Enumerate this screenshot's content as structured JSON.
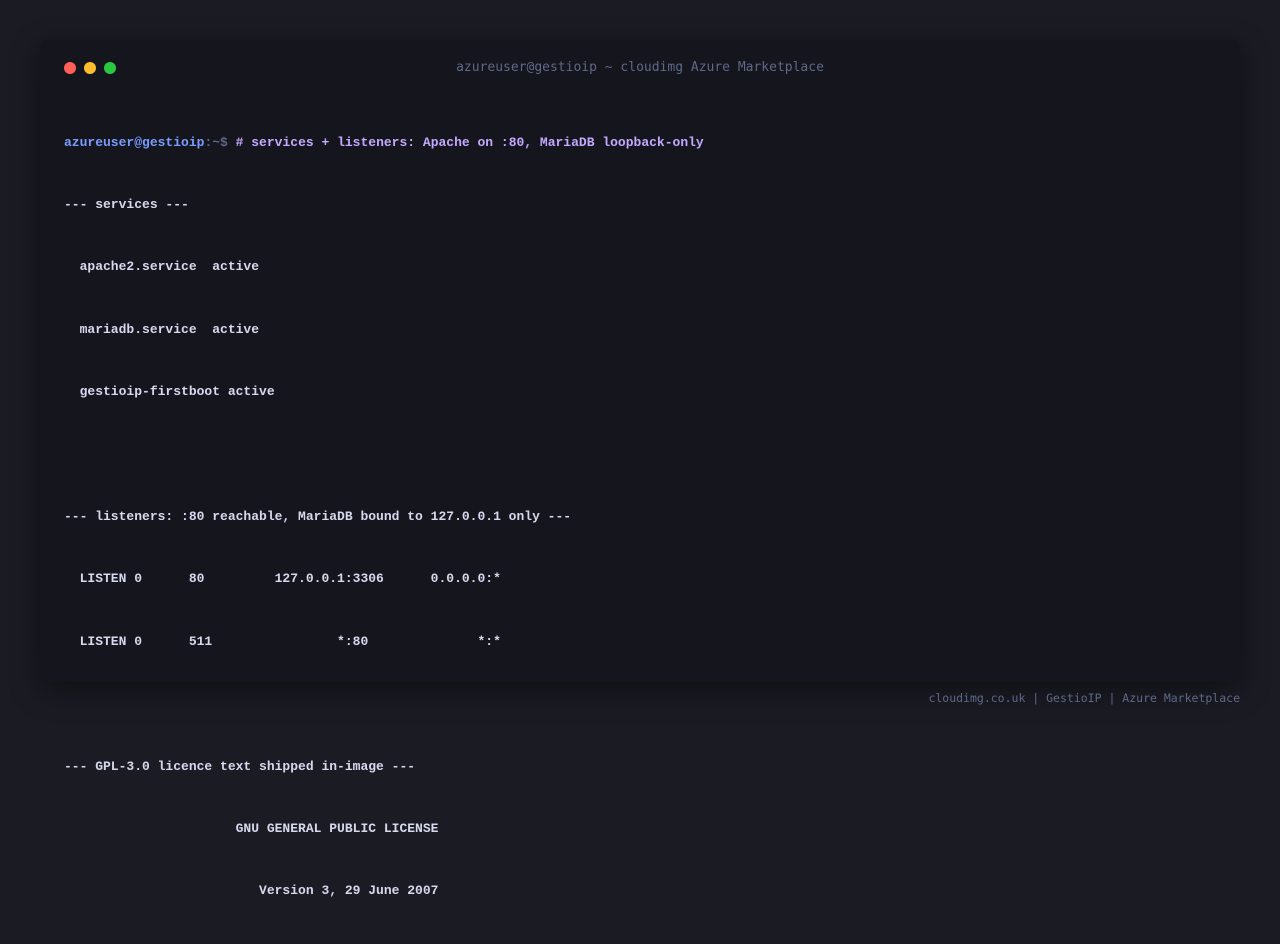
{
  "window": {
    "title": "azureuser@gestioip ~ cloudimg Azure Marketplace",
    "colors": {
      "close": "#ff5f57",
      "minimize": "#febc2e",
      "maximize": "#28c840",
      "prompt_user": "#7a9cff",
      "command": "#c4a8ff",
      "text": "#d6d8ee",
      "background": "#15151d"
    }
  },
  "terminal": {
    "prompt_user": "azureuser@gestioip",
    "prompt_path": ":~$",
    "command": "# services + listeners: Apache on :80, MariaDB loopback-only",
    "lines": [
      "--- services ---",
      "  apache2.service  active",
      "  mariadb.service  active",
      "  gestioip-firstboot active",
      "",
      "--- listeners: :80 reachable, MariaDB bound to 127.0.0.1 only ---",
      "  LISTEN 0      80         127.0.0.1:3306      0.0.0.0:*",
      "  LISTEN 0      511                *:80              *:*",
      "",
      "--- GPL-3.0 licence text shipped in-image ---",
      "                      GNU GENERAL PUBLIC LICENSE",
      "                         Version 3, 29 June 2007"
    ]
  },
  "footer": {
    "text": "cloudimg.co.uk | GestioIP | Azure Marketplace"
  }
}
